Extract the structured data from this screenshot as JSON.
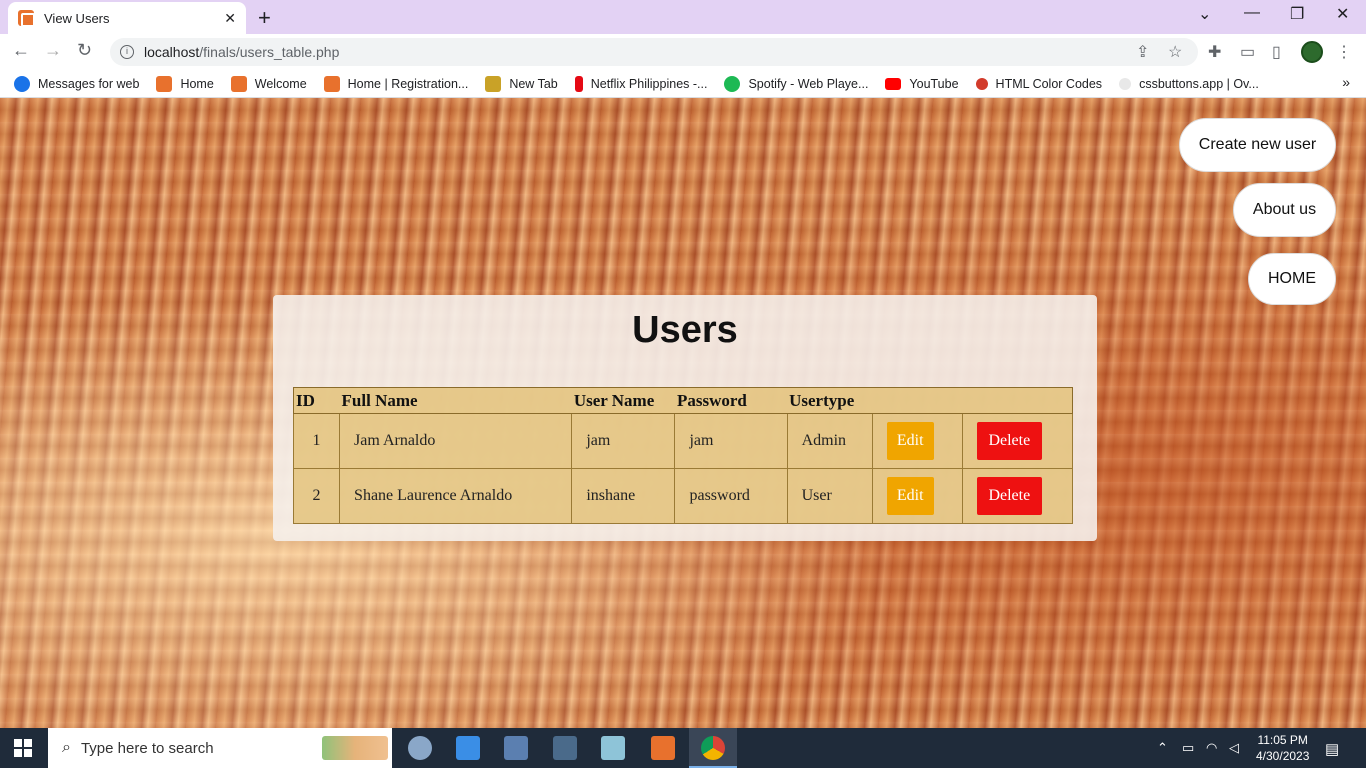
{
  "browser": {
    "tab_title": "View Users",
    "url_host": "localhost",
    "url_path": "/finals/users_table.php",
    "bookmarks": [
      {
        "label": "Messages for web",
        "color": "#1a73e8"
      },
      {
        "label": "Home",
        "color": "#e8712d"
      },
      {
        "label": "Welcome",
        "color": "#e8712d"
      },
      {
        "label": "Home | Registration...",
        "color": "#e8712d"
      },
      {
        "label": "New Tab",
        "color": "#c9a227"
      },
      {
        "label": "Netflix Philippines -...",
        "color": "#e50914"
      },
      {
        "label": "Spotify - Web Playe...",
        "color": "#1db954"
      },
      {
        "label": "YouTube",
        "color": "#ff0000"
      },
      {
        "label": "HTML Color Codes",
        "color": "#d23b2b"
      },
      {
        "label": "cssbuttons.app | Ov...",
        "color": "#bbbbbb"
      }
    ]
  },
  "page": {
    "nav": {
      "create_label": "Create new user",
      "about_label": "About us",
      "home_label": "HOME"
    },
    "title": "Users",
    "table": {
      "headers": [
        "ID",
        "Full Name",
        "User Name",
        "Password",
        "Usertype"
      ],
      "rows": [
        {
          "id": "1",
          "full_name": "Jam Arnaldo",
          "user_name": "jam",
          "password": "jam",
          "usertype": "Admin"
        },
        {
          "id": "2",
          "full_name": "Shane Laurence Arnaldo",
          "user_name": "inshane",
          "password": "password",
          "usertype": "User"
        }
      ],
      "edit_label": "Edit",
      "delete_label": "Delete"
    },
    "colors": {
      "edit": "#f0a500",
      "delete": "#ee1111"
    }
  },
  "taskbar": {
    "search_placeholder": "Type here to search",
    "time": "11:05 PM",
    "date": "4/30/2023"
  }
}
